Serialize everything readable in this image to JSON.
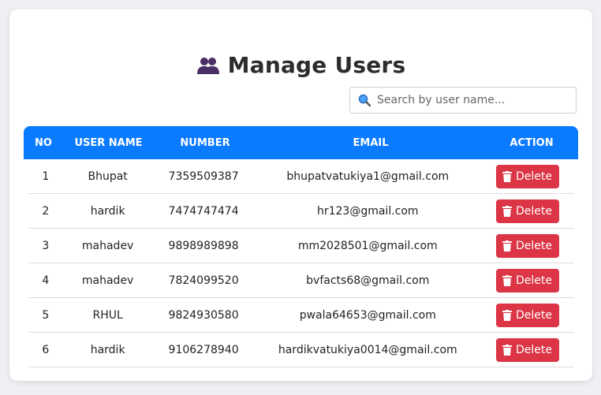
{
  "page": {
    "title": "Manage Users",
    "accent_color": "#0a7bff",
    "delete_color": "#dc3545",
    "title_icon": "users-icon"
  },
  "search": {
    "placeholder": "Search by user name...",
    "value": "",
    "icon": "search-icon"
  },
  "table": {
    "headers": {
      "no": "NO",
      "user": "USER NAME",
      "number": "NUMBER",
      "email": "EMAIL",
      "action": "ACTION"
    },
    "rows": [
      {
        "no": "1",
        "user": "Bhupat",
        "number": "7359509387",
        "email": "bhupatvatukiya1@gmail.com",
        "action": "Delete"
      },
      {
        "no": "2",
        "user": "hardik",
        "number": "7474747474",
        "email": "hr123@gmail.com",
        "action": "Delete"
      },
      {
        "no": "3",
        "user": "mahadev",
        "number": "9898989898",
        "email": "mm2028501@gmail.com",
        "action": "Delete"
      },
      {
        "no": "4",
        "user": "mahadev",
        "number": "7824099520",
        "email": "bvfacts68@gmail.com",
        "action": "Delete"
      },
      {
        "no": "5",
        "user": "RHUL",
        "number": "9824930580",
        "email": "pwala64653@gmail.com",
        "action": "Delete"
      },
      {
        "no": "6",
        "user": "hardik",
        "number": "9106278940",
        "email": "hardikvatukiya0014@gmail.com",
        "action": "Delete"
      }
    ]
  }
}
